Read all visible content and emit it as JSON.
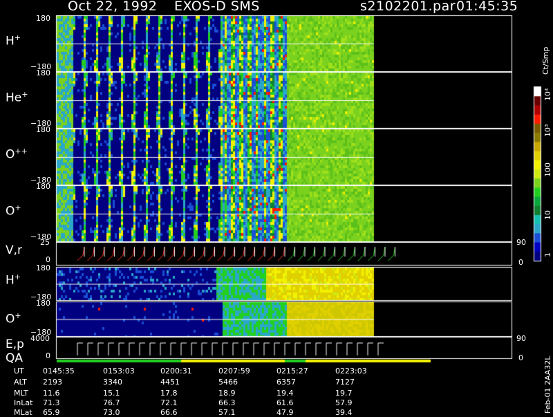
{
  "header": {
    "date": "Oct 22, 1992",
    "instrument": "EXOS-D SMS",
    "file": "s2102201.par",
    "time": "01:45:35"
  },
  "colorbar": {
    "unit": "Ct/Smp",
    "ticks": [
      "1",
      "10",
      "100",
      "10³",
      "10⁴"
    ],
    "colors": [
      "#000080",
      "#0000c0",
      "#1a4fd6",
      "#2aa7c8",
      "#16c0b0",
      "#0f7f30",
      "#0aa83c",
      "#22d020",
      "#7ad41c",
      "#cfe812",
      "#f2f200",
      "#e0d000",
      "#c8a800",
      "#8a7a00",
      "#7a5c00",
      "#ff1a00",
      "#b00000",
      "#6a0000",
      "#ffffff"
    ]
  },
  "panels": [
    {
      "label_main": "H",
      "label_sup": "+",
      "ymax": "180",
      "ymin": "−180"
    },
    {
      "label_main": "He",
      "label_sup": "+",
      "ymax": "180",
      "ymin": "−180"
    },
    {
      "label_main": "O",
      "label_sup": "++",
      "ymax": "180",
      "ymin": "−180"
    },
    {
      "label_main": "O",
      "label_sup": "+",
      "ymax": "180",
      "ymin": "−180"
    },
    {
      "label_main": "V,r",
      "label_sup": "",
      "ymax": "25",
      "ymin": "0",
      "right_max": "90",
      "right_min": "0"
    },
    {
      "label_main": "H",
      "label_sup": "+",
      "ymax": "180",
      "ymin": "−180"
    },
    {
      "label_main": "O",
      "label_sup": "+",
      "ymax": "180",
      "ymin": "−180",
      "right_max": "90"
    },
    {
      "label_main": "E,p",
      "label_sup": "",
      "label2": "QA",
      "ymax": "4000",
      "ymin": "0",
      "right_min": "0"
    }
  ],
  "footer": {
    "rows": [
      {
        "name": "UT",
        "values": [
          "0145:35",
          "0153:03",
          "0200:31",
          "0207:59",
          "0215:27",
          "0223:03"
        ]
      },
      {
        "name": "ALT",
        "values": [
          "2193",
          "3340",
          "4451",
          "5466",
          "6357",
          "7127"
        ]
      },
      {
        "name": "MLT",
        "values": [
          "11.6",
          "15.1",
          "17.8",
          "18.9",
          "19.4",
          "19.7"
        ]
      },
      {
        "name": "InLat",
        "values": [
          "71.3",
          "76.7",
          "72.1",
          "66.3",
          "61.6",
          "57.9"
        ]
      },
      {
        "name": "MLat",
        "values": [
          "65.9",
          "73.0",
          "66.6",
          "57.1",
          "47.9",
          "39.4"
        ]
      }
    ],
    "stamp": "Feb-01 2AA32L"
  },
  "chart_data": {
    "type": "heatmap",
    "title": "Oct 22, 1992   EXOS-D SMS",
    "x_ticks_UT": [
      "0145:35",
      "0153:03",
      "0200:31",
      "0207:59",
      "0215:27",
      "0223:03"
    ],
    "colorbar_unit": "Ct/Smp",
    "colorbar_scale": "log",
    "colorbar_range": [
      1,
      10000
    ],
    "series": [
      {
        "name": "H+",
        "ylim": [
          -180,
          180
        ]
      },
      {
        "name": "He+",
        "ylim": [
          -180,
          180
        ]
      },
      {
        "name": "O++",
        "ylim": [
          -180,
          180
        ]
      },
      {
        "name": "O+",
        "ylim": [
          -180,
          180
        ]
      },
      {
        "name": "V,r",
        "ylim": [
          0,
          25
        ],
        "right_ylim": [
          0,
          90
        ]
      },
      {
        "name": "H+",
        "ylim": [
          -180,
          180
        ]
      },
      {
        "name": "O+",
        "ylim": [
          -180,
          180
        ]
      },
      {
        "name": "E,p",
        "ylim": [
          0,
          4000
        ],
        "right_ylim": [
          0,
          90
        ]
      }
    ]
  }
}
